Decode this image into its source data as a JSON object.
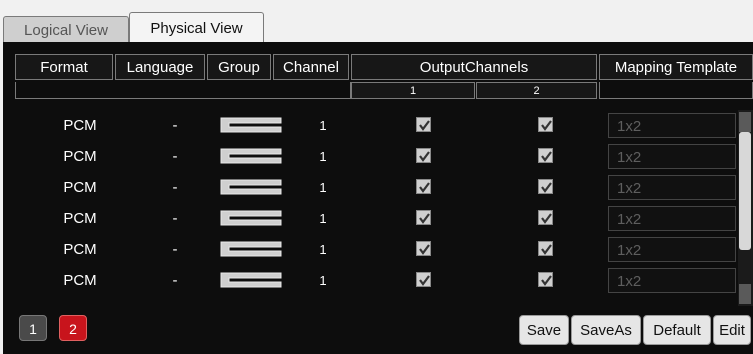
{
  "tabs": {
    "logical": "Logical View",
    "physical": "Physical View"
  },
  "headers": {
    "format": "Format",
    "language": "Language",
    "group": "Group",
    "channel": "Channel",
    "output_channels": "OutputChannels",
    "out1": "1",
    "out2": "2",
    "mapping_template": "Mapping Template"
  },
  "rows": [
    {
      "format": "PCM",
      "language": "-",
      "channel": "1",
      "out1": true,
      "out2": true,
      "template": "1x2"
    },
    {
      "format": "PCM",
      "language": "-",
      "channel": "1",
      "out1": true,
      "out2": true,
      "template": "1x2"
    },
    {
      "format": "PCM",
      "language": "-",
      "channel": "1",
      "out1": true,
      "out2": true,
      "template": "1x2"
    },
    {
      "format": "PCM",
      "language": "-",
      "channel": "1",
      "out1": true,
      "out2": true,
      "template": "1x2"
    },
    {
      "format": "PCM",
      "language": "-",
      "channel": "1",
      "out1": true,
      "out2": true,
      "template": "1x2"
    },
    {
      "format": "PCM",
      "language": "-",
      "channel": "1",
      "out1": true,
      "out2": true,
      "template": "1x2"
    }
  ],
  "pages": {
    "p1": "1",
    "p2": "2",
    "active": "2"
  },
  "buttons": {
    "save": "Save",
    "save_as": "SaveAs",
    "default": "Default",
    "edit": "Edit"
  },
  "colors": {
    "accent_red": "#c8141c",
    "panel_bg": "#0d0d0d"
  }
}
